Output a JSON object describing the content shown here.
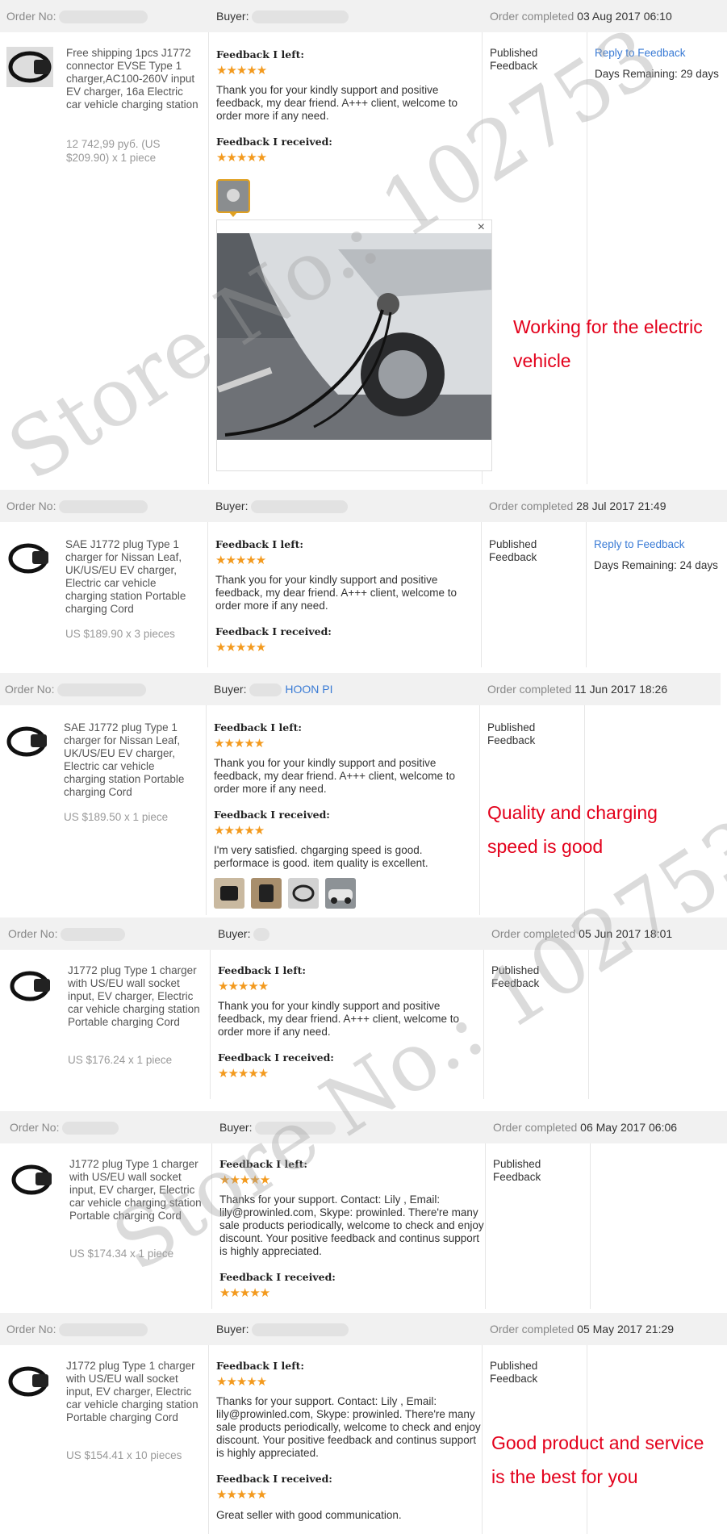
{
  "labels": {
    "order_no": "Order No:",
    "buyer": "Buyer:",
    "order_completed": "Order completed",
    "feedback_left": "Feedback I left:",
    "feedback_received": "Feedback I received:",
    "published": "Published Feedback",
    "reply": "Reply to Feedback",
    "close": "×"
  },
  "stars": "★★★★★",
  "orders": [
    {
      "date": "03 Aug 2017 06:10",
      "product": "Free shipping 1pcs J1772 connector EVSE Type 1 charger,AC100-260V input EV charger, 16a Electric car vehicle charging station",
      "price": "12 742,99 руб. (US $209.90) x 1 piece",
      "left_text": "Thank you for your kindly support and positive feedback, my dear friend. A+++ client, welcome to order more if any need.",
      "received_text": "",
      "days": "Days Remaining: 29 days",
      "annotation": "Working for the electric vehicle"
    },
    {
      "date": "28 Jul 2017 21:49",
      "product": "SAE J1772 plug Type 1 charger for Nissan Leaf, UK/US/EU EV charger, Electric car vehicle charging station Portable charging Cord",
      "price": "US $189.90 x 3 pieces",
      "left_text": "Thank you for your kindly support and positive feedback, my dear friend. A+++ client, welcome to order more if any need.",
      "received_text": "",
      "days": "Days Remaining: 24 days"
    },
    {
      "date": "11 Jun 2017 18:26",
      "buyer_partial": "HOON PI",
      "product": "SAE J1772 plug Type 1 charger for Nissan Leaf, UK/US/EU EV charger, Electric car vehicle charging station Portable charging Cord",
      "price": "US $189.50 x 1 piece",
      "left_text": "Thank you for your kindly support and positive feedback, my dear friend. A+++ client, welcome to order more if any need.",
      "received_text": "I'm very satisfied. chgarging speed is good. performace is good. item quality is excellent.",
      "annotation": "Quality and charging speed is good"
    },
    {
      "date": "05 Jun 2017 18:01",
      "product": "J1772 plug Type 1 charger with US/EU wall socket input, EV charger, Electric car vehicle charging station Portable charging Cord",
      "price": "US $176.24 x 1 piece",
      "left_text": "Thank you for your kindly support and positive feedback, my dear friend. A+++ client, welcome to order more if any need.",
      "received_text": ""
    },
    {
      "date": "06 May 2017 06:06",
      "product": "J1772 plug Type 1 charger with US/EU wall socket input, EV charger, Electric car vehicle charging station Portable charging Cord",
      "price": "US $174.34 x 1 piece",
      "left_text": "Thanks for your support. Contact: Lily , Email: lily@prowinled.com, Skype: prowinled. There're many sale products periodically, welcome to check and enjoy discount. Your positive feedback and continus support is highly appreciated.",
      "received_text": ""
    },
    {
      "date": "05 May 2017 21:29",
      "product": "J1772 plug Type 1 charger with US/EU wall socket input, EV charger, Electric car vehicle charging station Portable charging Cord",
      "price": "US $154.41 x 10 pieces",
      "left_text": "Thanks for your support. Contact: Lily , Email: lily@prowinled.com, Skype: prowinled. There're many sale products periodically, welcome to check and enjoy discount. Your positive feedback and continus support is highly appreciated.",
      "received_text": "Great seller with good communication.",
      "annotation": "Good product and service is the best for you"
    }
  ],
  "watermark": "Store No.: 102753",
  "colors": {
    "header_bg": "#f1f1f1",
    "star": "#f39a1e",
    "link": "#3a7bd5",
    "annotation": "#e3001b"
  }
}
